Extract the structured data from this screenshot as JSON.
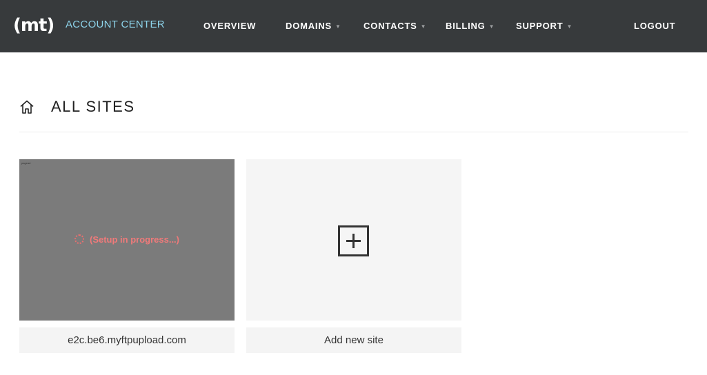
{
  "header": {
    "logo_text": "(mt)",
    "app_title": "ACCOUNT CENTER",
    "nav": {
      "overview": "OVERVIEW",
      "domains": "DOMAINS",
      "contacts": "CONTACTS",
      "billing": "BILLING",
      "support": "SUPPORT",
      "logout": "LOGOUT"
    },
    "caret": "▼"
  },
  "page": {
    "title": "ALL SITES"
  },
  "sites": [
    {
      "domain": "e2c.be6.myftpupload.com",
      "status": "(Setup in progress...)",
      "thumb_corner_text": "pagead"
    }
  ],
  "add_site": {
    "label": "Add new site"
  },
  "colors": {
    "topbar": "#373a3c",
    "app_title": "#8dd3ea",
    "status_text": "#f07a7a",
    "thumb_gray": "#7b7b7b",
    "card_bg": "#f5f5f5"
  }
}
